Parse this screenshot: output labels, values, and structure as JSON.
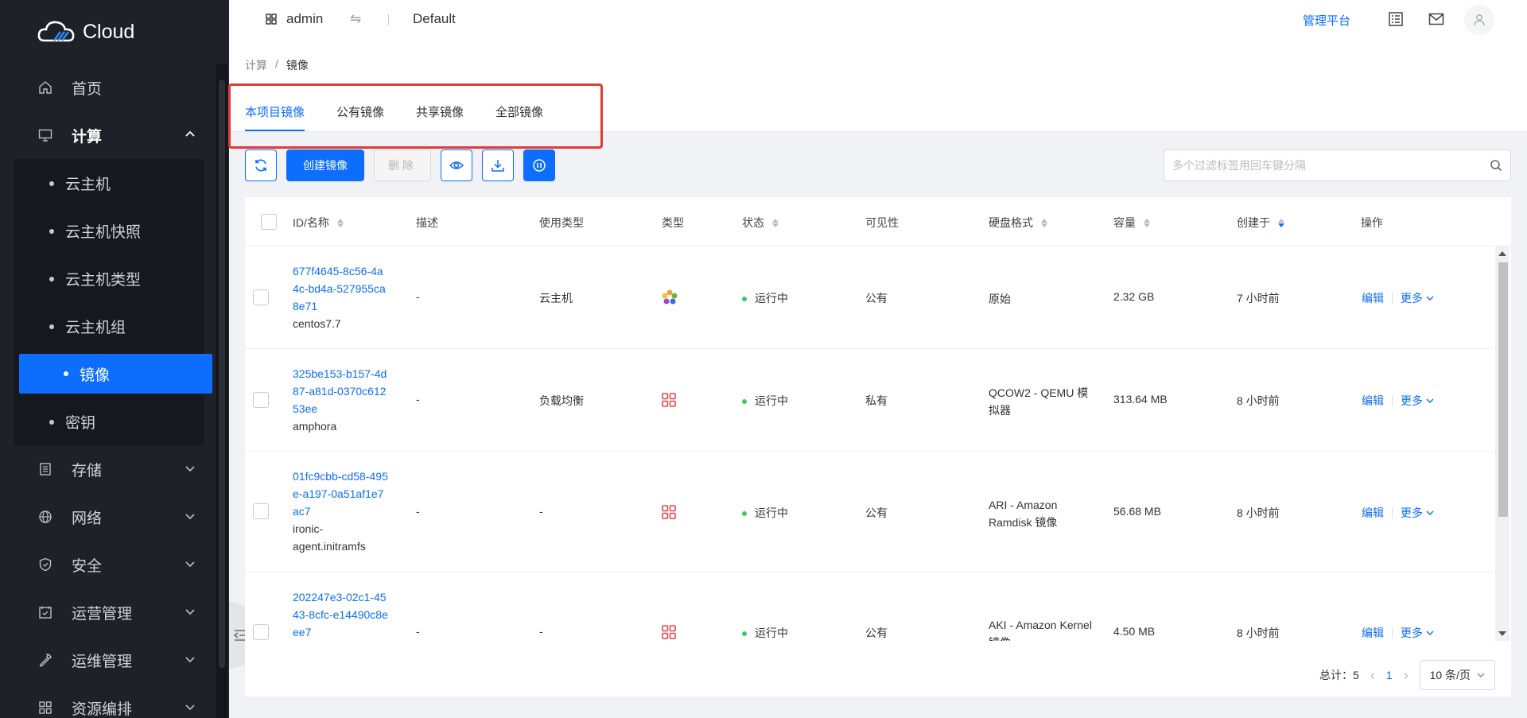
{
  "brand": {
    "name": "Cloud"
  },
  "header": {
    "project": "admin",
    "domain": "Default",
    "admin_link": "管理平台"
  },
  "sidebar": {
    "items": [
      {
        "label": "首页",
        "icon": "home-icon"
      },
      {
        "label": "计算",
        "icon": "monitor-icon",
        "open": true,
        "children": [
          "云主机",
          "云主机快照",
          "云主机类型",
          "云主机组",
          "镜像",
          "密钥"
        ],
        "active_child": "镜像"
      },
      {
        "label": "存储",
        "icon": "storage-icon"
      },
      {
        "label": "网络",
        "icon": "globe-icon"
      },
      {
        "label": "安全",
        "icon": "shield-icon"
      },
      {
        "label": "运营管理",
        "icon": "calendar-icon"
      },
      {
        "label": "运维管理",
        "icon": "wrench-icon"
      },
      {
        "label": "资源编排",
        "icon": "grid-icon"
      }
    ]
  },
  "breadcrumb": {
    "parent": "计算",
    "current": "镜像",
    "sep": "/"
  },
  "tabs": [
    "本项目镜像",
    "公有镜像",
    "共享镜像",
    "全部镜像"
  ],
  "toolbar": {
    "create": "创建镜像",
    "delete": "删除"
  },
  "search": {
    "placeholder": "多个过滤标签用回车键分隔"
  },
  "table": {
    "headers": [
      "ID/名称",
      "描述",
      "使用类型",
      "类型",
      "状态",
      "可见性",
      "硬盘格式",
      "容量",
      "创建于",
      "操作"
    ],
    "rows": [
      {
        "id": "677f4645-8c56-4a4c-bd4a-527955ca8e71",
        "name": "centos7.7",
        "desc": "-",
        "usage": "云主机",
        "type_icon": "os-flower-icon",
        "status": "运行中",
        "visibility": "公有",
        "format": "原始",
        "size": "2.32 GB",
        "created": "7 小时前"
      },
      {
        "id": "325be153-b157-4d87-a81d-0370c61253ee",
        "name": "amphora",
        "desc": "-",
        "usage": "负载均衡",
        "type_icon": "apps-icon",
        "status": "运行中",
        "visibility": "私有",
        "format": "QCOW2 - QEMU 模拟器",
        "size": "313.64 MB",
        "created": "8 小时前"
      },
      {
        "id": "01fc9cbb-cd58-495e-a197-0a51af1e7ac7",
        "name": "ironic-agent.initramfs",
        "desc": "-",
        "usage": "-",
        "type_icon": "apps-icon",
        "status": "运行中",
        "visibility": "公有",
        "format": "ARI - Amazon Ramdisk 镜像",
        "size": "56.68 MB",
        "created": "8 小时前"
      },
      {
        "id": "202247e3-02c1-4543-8cfc-e14490c8eee7",
        "name": "",
        "desc": "-",
        "usage": "-",
        "type_icon": "apps-icon",
        "status": "运行中",
        "visibility": "公有",
        "format": "AKI - Amazon Kernel 镜像",
        "size": "4.50 MB",
        "created": "8 小时前"
      }
    ],
    "ops": {
      "edit": "编辑",
      "more": "更多"
    }
  },
  "pager": {
    "total_label": "总计：",
    "total": "5",
    "page": "1",
    "page_size": "10 条/页"
  }
}
